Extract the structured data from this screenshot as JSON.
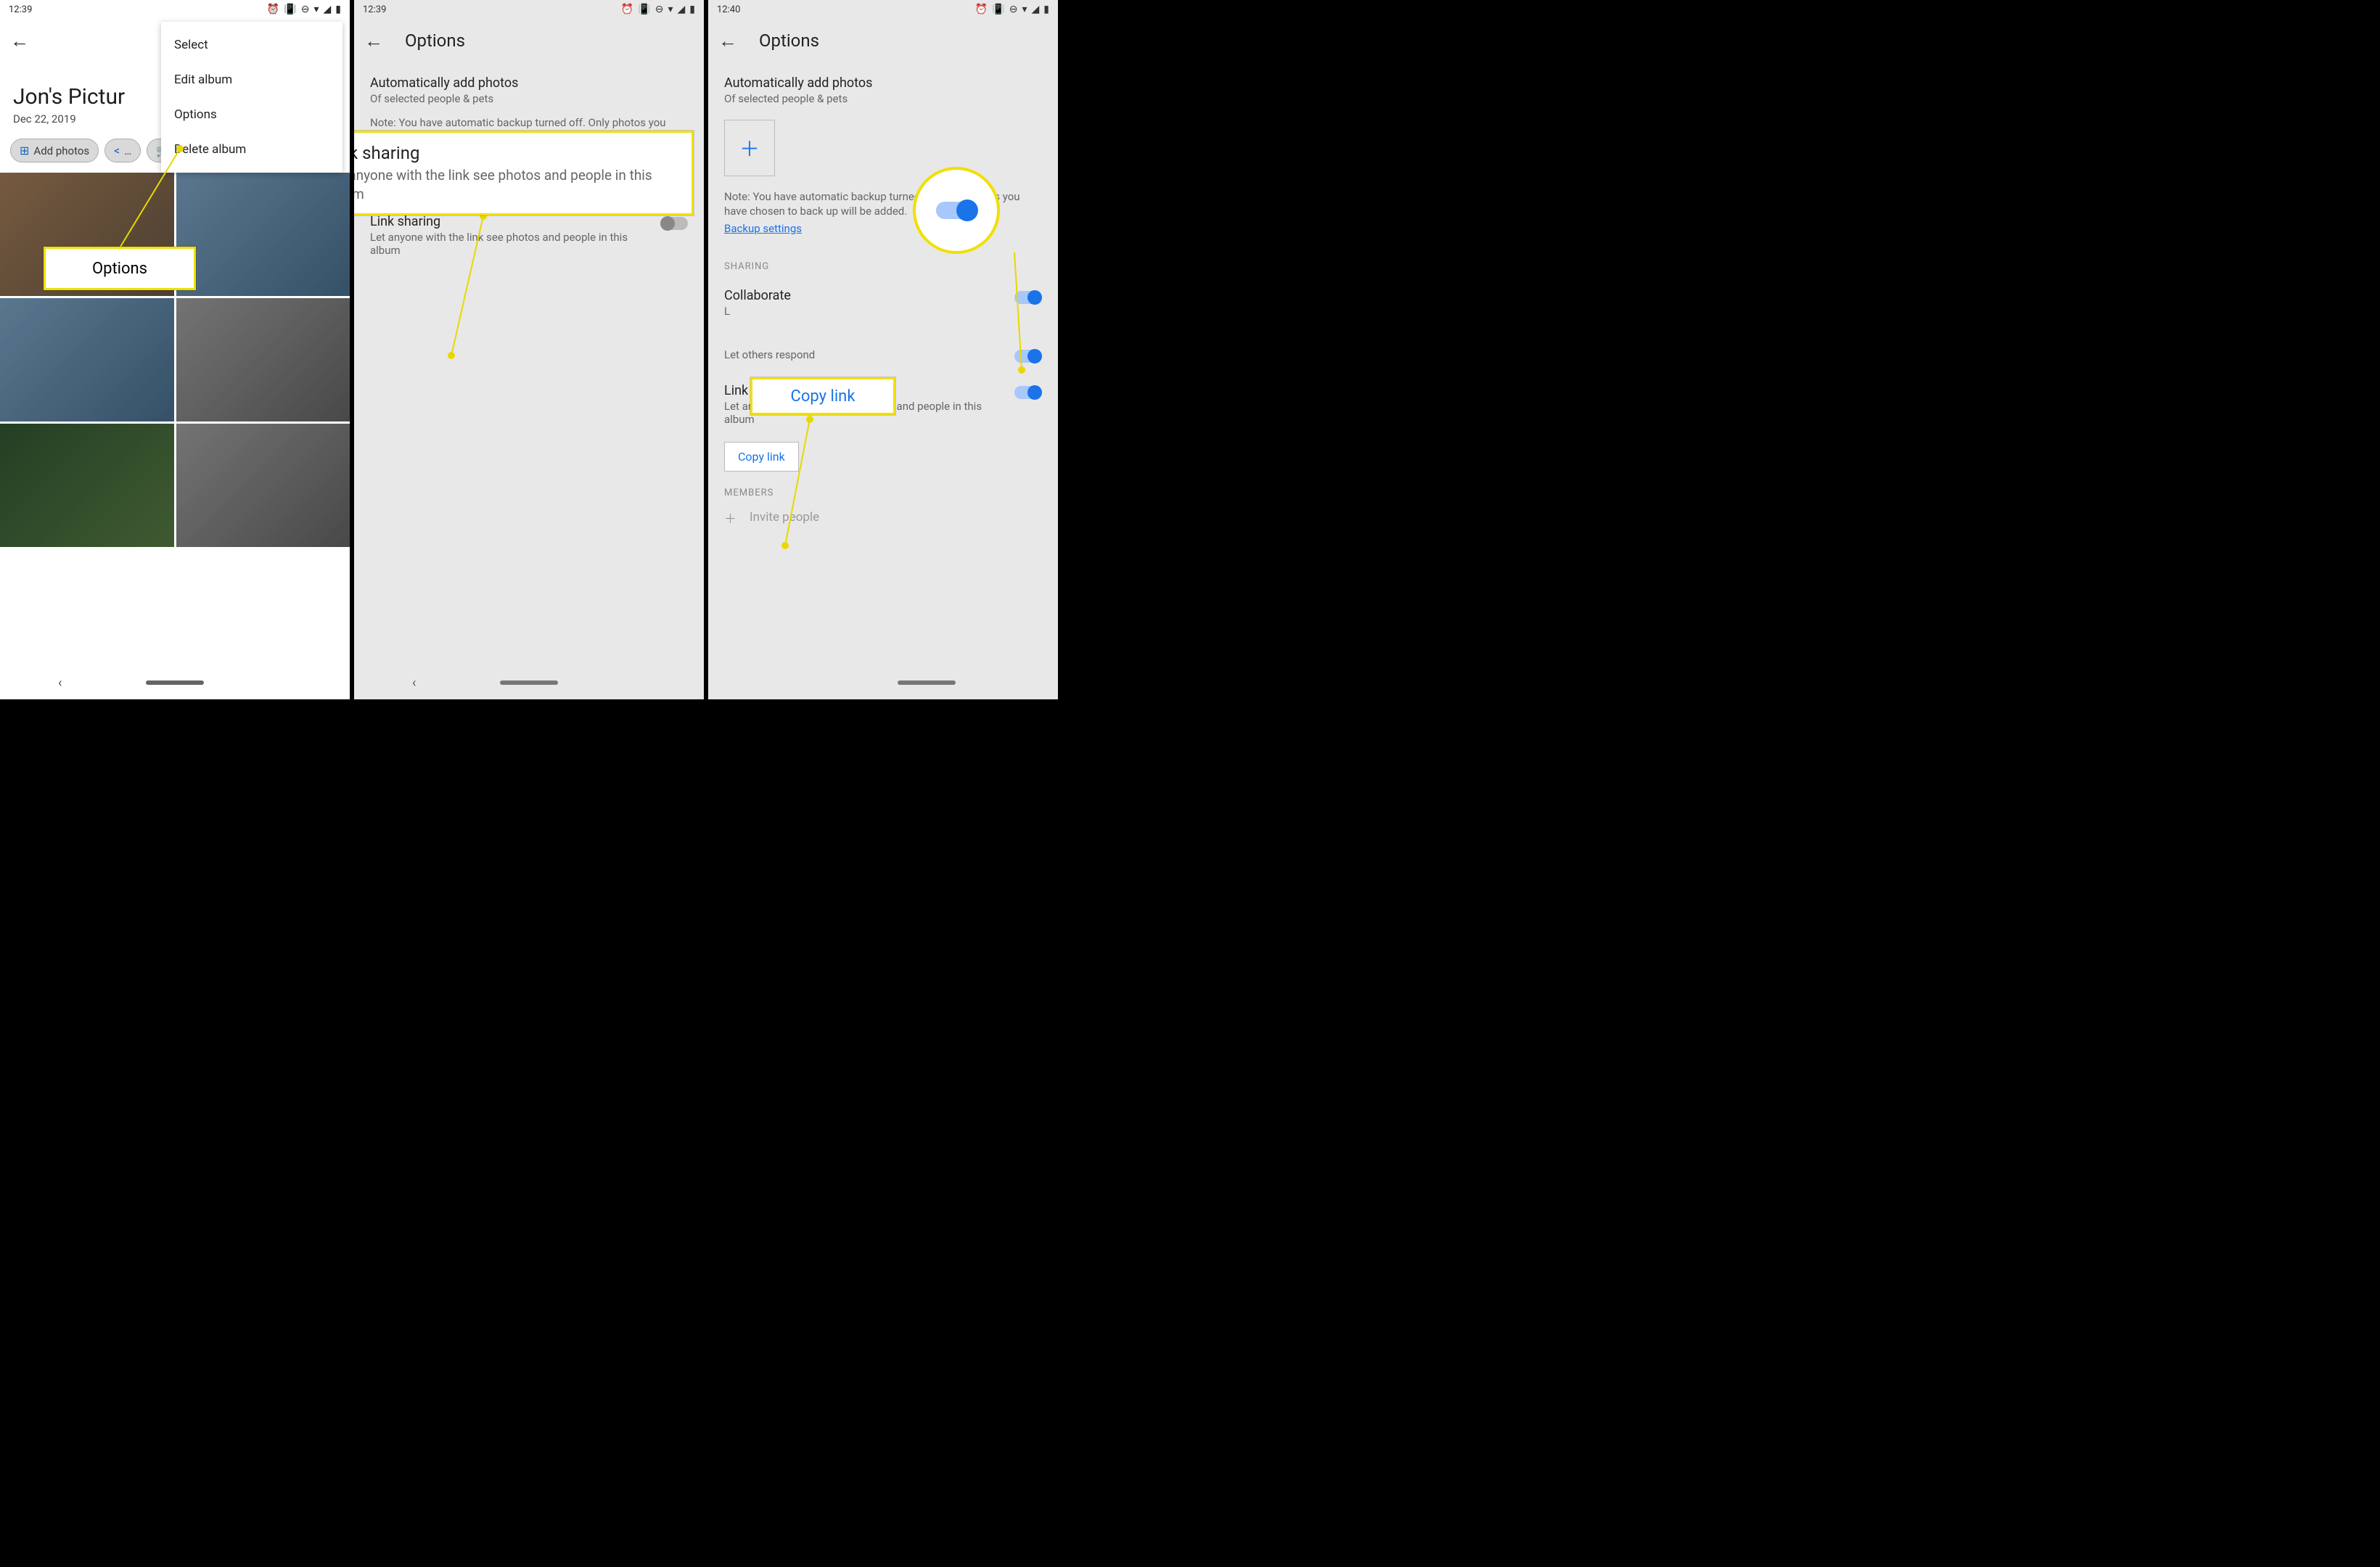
{
  "status": {
    "t1": "12:39",
    "t2": "12:39",
    "t3": "12:40"
  },
  "s1": {
    "album_title": "Jon's Pictur",
    "album_date": "Dec 22, 2019",
    "add_photos": "Add photos",
    "menu": {
      "select": "Select",
      "edit": "Edit album",
      "options": "Options",
      "delete": "Delete album"
    },
    "callout": "Options"
  },
  "opts": {
    "header": "Options",
    "auto_title": "Automatically add photos",
    "auto_sub": "Of selected people & pets",
    "note": "Note: You have automatic backup turned off. Only photos you have chosen to back up will be added.",
    "backup": "Backup settings",
    "sharing_cat": "SHARING",
    "link_title": "Link sharing",
    "link_sub": "Let anyone with the link see photos and people in this album",
    "collab_title": "Collaborate",
    "collab_sub": "L",
    "comments_sub": "Let others respond",
    "copy": "Copy link",
    "members_cat": "MEMBERS",
    "invite": "Invite people"
  },
  "s2": {
    "callout_title": "Link sharing",
    "callout_body": "Let anyone with the link see photos and people in this album"
  },
  "s3": {
    "callout_copy": "Copy link"
  }
}
